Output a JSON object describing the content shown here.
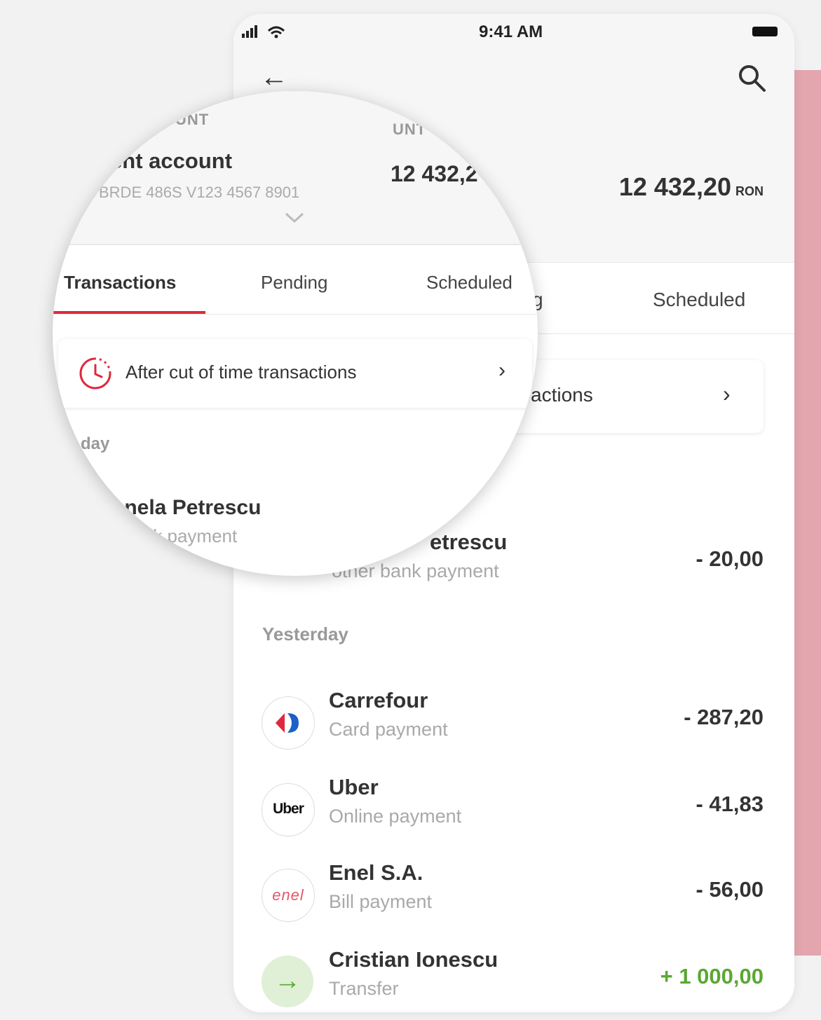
{
  "colors": {
    "accent": "#e0283c",
    "positive": "#5aa832",
    "background_card": "#e3a6ae"
  },
  "status_bar": {
    "time": "9:41 AM",
    "signal": "..ıl ◠"
  },
  "header": {
    "back_icon": "arrow-left-icon",
    "search_icon": "search-icon"
  },
  "account": {
    "section_label_left": "COUNT",
    "section_label_right": "UNT",
    "name": "rent account",
    "iban": "BRDE 486S V123 4567 8901",
    "balance_short": "12 432,2",
    "balance": "12 432,20",
    "currency": "RON"
  },
  "tabs": {
    "items": [
      "Transactions",
      "Pending",
      "Scheduled"
    ],
    "active": "Transactions",
    "behind_pending_fragment": "g"
  },
  "cut_off": {
    "label": "After cut of time transactions",
    "label_fragment": "actions"
  },
  "today": {
    "label": "day",
    "tx": {
      "name_fragment": "onela Petrescu",
      "sub_fragment": "r bank payment",
      "name_behind": "etrescu",
      "sub_behind": "other bank payment",
      "amount": "- 20,00"
    }
  },
  "yesterday": {
    "label": "Yesterday",
    "transactions": [
      {
        "name": "Carrefour",
        "type": "Card payment",
        "amount": "- 287,20",
        "icon": "carrefour-logo"
      },
      {
        "name": "Uber",
        "type": "Online payment",
        "amount": "- 41,83",
        "icon": "uber-logo",
        "logo_text": "Uber"
      },
      {
        "name": "Enel S.A.",
        "type": "Bill payment",
        "amount": "- 56,00",
        "icon": "enel-logo",
        "logo_text": "enel"
      },
      {
        "name": "Cristian Ionescu",
        "type": "Transfer",
        "amount": "+ 1 000,00",
        "icon": "arrow-right-icon",
        "logo_text": "→"
      }
    ]
  }
}
